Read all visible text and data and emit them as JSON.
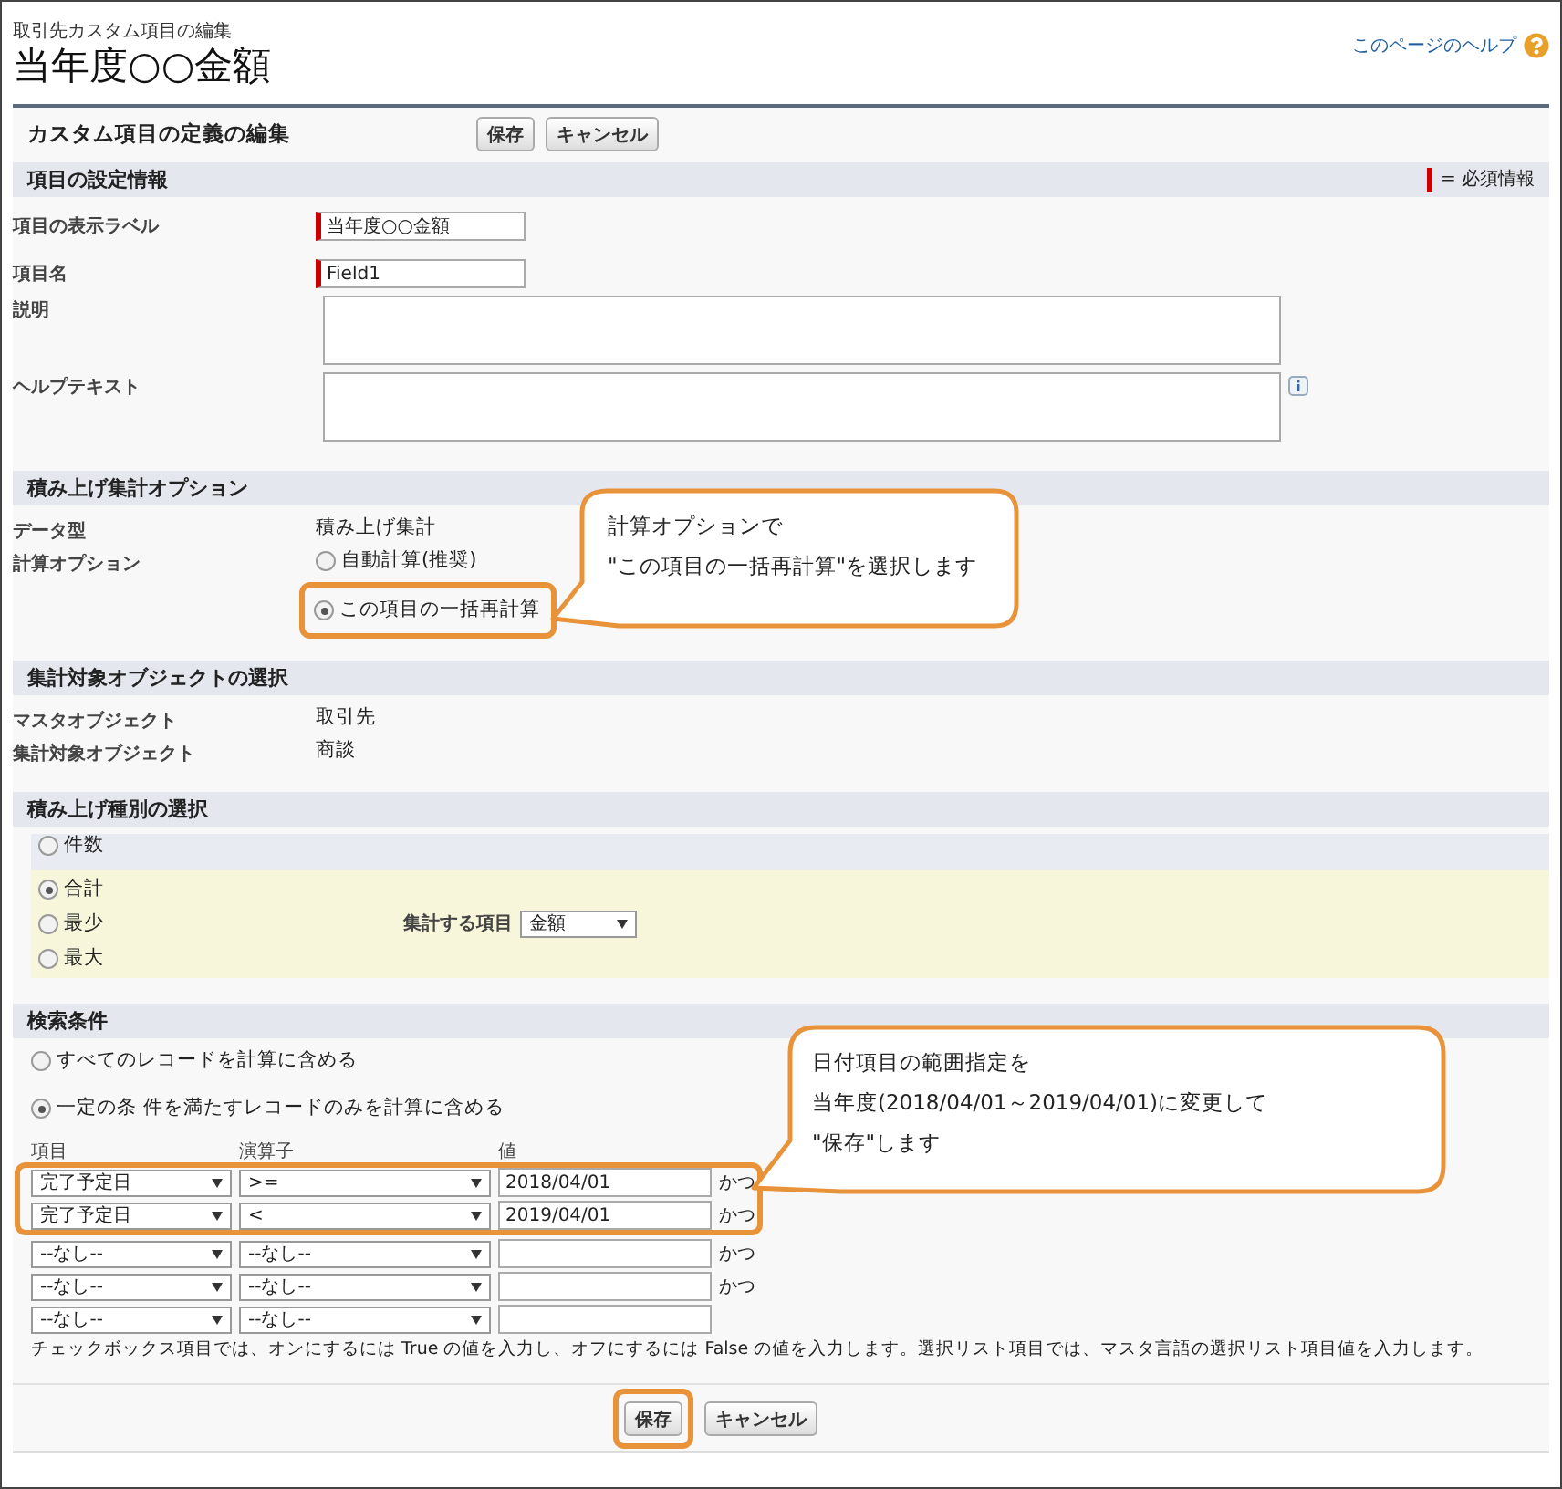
{
  "header": {
    "breadcrumb": "取引先カスタム項目の編集",
    "title": "当年度○○金額",
    "help_link": "このページのヘルプ"
  },
  "panel": {
    "title": "カスタム項目の定義の編集",
    "buttons": [
      {
        "label": "保存",
        "highlighted": false
      },
      {
        "label": "キャンセル",
        "highlighted": false
      }
    ]
  },
  "sections": [
    {
      "kind": "fields",
      "title": "項目の設定情報",
      "legend": "= 必須情報",
      "rows": [
        {
          "kind": "input",
          "label": "項目の表示ラベル",
          "value": "当年度○○金額",
          "required": true
        },
        {
          "kind": "input",
          "label": "項目名",
          "value": "Field1",
          "required": true
        },
        {
          "kind": "textarea",
          "label": "説明",
          "info": false
        },
        {
          "kind": "textarea",
          "label": "ヘルプテキスト",
          "info": true
        }
      ]
    },
    {
      "kind": "fields",
      "title": "積み上げ集計オプション",
      "rows": [
        {
          "kind": "text",
          "label": "データ型",
          "value": "積み上げ集計"
        },
        {
          "kind": "radios",
          "label": "計算オプション",
          "options": [
            {
              "label": "自動計算(推奨)",
              "selected": false,
              "highlighted": false
            },
            {
              "label": "この項目の一括再計算",
              "selected": true,
              "highlighted": true
            }
          ]
        }
      ]
    },
    {
      "kind": "fields",
      "title": "集計対象オブジェクトの選択",
      "rows": [
        {
          "kind": "text",
          "label": "マスタオブジェクト",
          "value": "取引先"
        },
        {
          "kind": "text",
          "label": "集計対象オブジェクト",
          "value": "商談"
        }
      ]
    },
    {
      "kind": "rollup",
      "title": "積み上げ種別の選択",
      "options": [
        {
          "label": "件数",
          "selected": false
        },
        {
          "label": "合計",
          "selected": true
        },
        {
          "label": "最少",
          "selected": false
        },
        {
          "label": "最大",
          "selected": false
        }
      ],
      "field_label": "集計する項目",
      "field_value": "金額"
    },
    {
      "kind": "filter",
      "title": "検索条件",
      "options": [
        {
          "label": "すべてのレコードを計算に含める",
          "selected": false
        },
        {
          "label": "一定の条 件を満たすレコードのみを計算に含める",
          "selected": true
        }
      ],
      "columns": [
        "項目",
        "演算子",
        "値"
      ],
      "rows": [
        {
          "field": "完了予定日",
          "operator": ">=",
          "value": "2018/04/01",
          "conjunction": "かつ",
          "highlighted": true
        },
        {
          "field": "完了予定日",
          "operator": "<",
          "value": "2019/04/01",
          "conjunction": "かつ",
          "highlighted": true
        },
        {
          "field": "--なし--",
          "operator": "--なし--",
          "conjunction": "かつ",
          "highlighted": false
        },
        {
          "field": "--なし--",
          "operator": "--なし--",
          "conjunction": "かつ",
          "highlighted": false
        },
        {
          "field": "--なし--",
          "operator": "--なし--",
          "highlighted": false
        }
      ],
      "note": "チェックボックス項目では、オンにするには True の値を入力し、オフにするには False の値を入力します。選択リスト項目では、マスタ言語の選択リスト項目値を入力します。"
    }
  ],
  "bottom_buttons": [
    {
      "label": "保存",
      "highlighted": true
    },
    {
      "label": "キャンセル",
      "highlighted": false
    }
  ],
  "callouts": [
    {
      "lines": [
        "計算オプションで",
        "\"この項目の一括再計算\"を選択します"
      ]
    },
    {
      "lines": [
        "日付項目の範囲指定を",
        "当年度(2018/04/01～2019/04/01)に変更して",
        "\"保存\"します"
      ]
    }
  ]
}
